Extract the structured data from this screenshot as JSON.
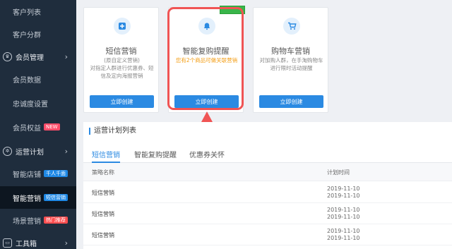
{
  "sidebar": {
    "items": [
      {
        "label": "客户列表"
      },
      {
        "label": "客户分群"
      },
      {
        "label": "会员管理"
      },
      {
        "label": "会员数据"
      },
      {
        "label": "忠诚度设置"
      },
      {
        "label": "会员权益",
        "badge": "NEW"
      },
      {
        "label": "运营计划"
      },
      {
        "label": "智能店铺",
        "badge": "千人千面"
      },
      {
        "label": "智能营销",
        "badge": "短信营销"
      },
      {
        "label": "场景营销",
        "badge": "热门推荐"
      },
      {
        "label": "工具箱"
      }
    ]
  },
  "cards": [
    {
      "title": "短信营销",
      "desc": "(原自定义营销)\n对指定人群进行优惠券、短信及定向海报营销",
      "button": "立即创建",
      "icon": "sms-icon"
    },
    {
      "title": "智能复购提醒",
      "desc": "您有2个商品可做关联营销",
      "button": "立即创建",
      "icon": "bell-icon"
    },
    {
      "title": "购物车营销",
      "desc": "对加购人群，在手淘购物车进行限时活动提醒",
      "button": "立即创建",
      "icon": "cart-icon"
    }
  ],
  "list": {
    "section_title": "运营计划列表",
    "tabs": [
      "短信营销",
      "智能复购提醒",
      "优惠券关怀"
    ],
    "columns": {
      "name": "策略名称",
      "time": "计划时间"
    },
    "rows": [
      {
        "name": "短信营销",
        "time1": "2019-11-10",
        "time2": "2019-11-10"
      },
      {
        "name": "短信营销",
        "time1": "2019-11-10",
        "time2": "2019-11-10"
      },
      {
        "name": "短信营销",
        "time1": "2019-11-10",
        "time2": "2019-11-10"
      }
    ]
  },
  "colors": {
    "accent": "#2b8ae2",
    "sidebar": "#1f2d3d",
    "highlight": "#f05454"
  }
}
